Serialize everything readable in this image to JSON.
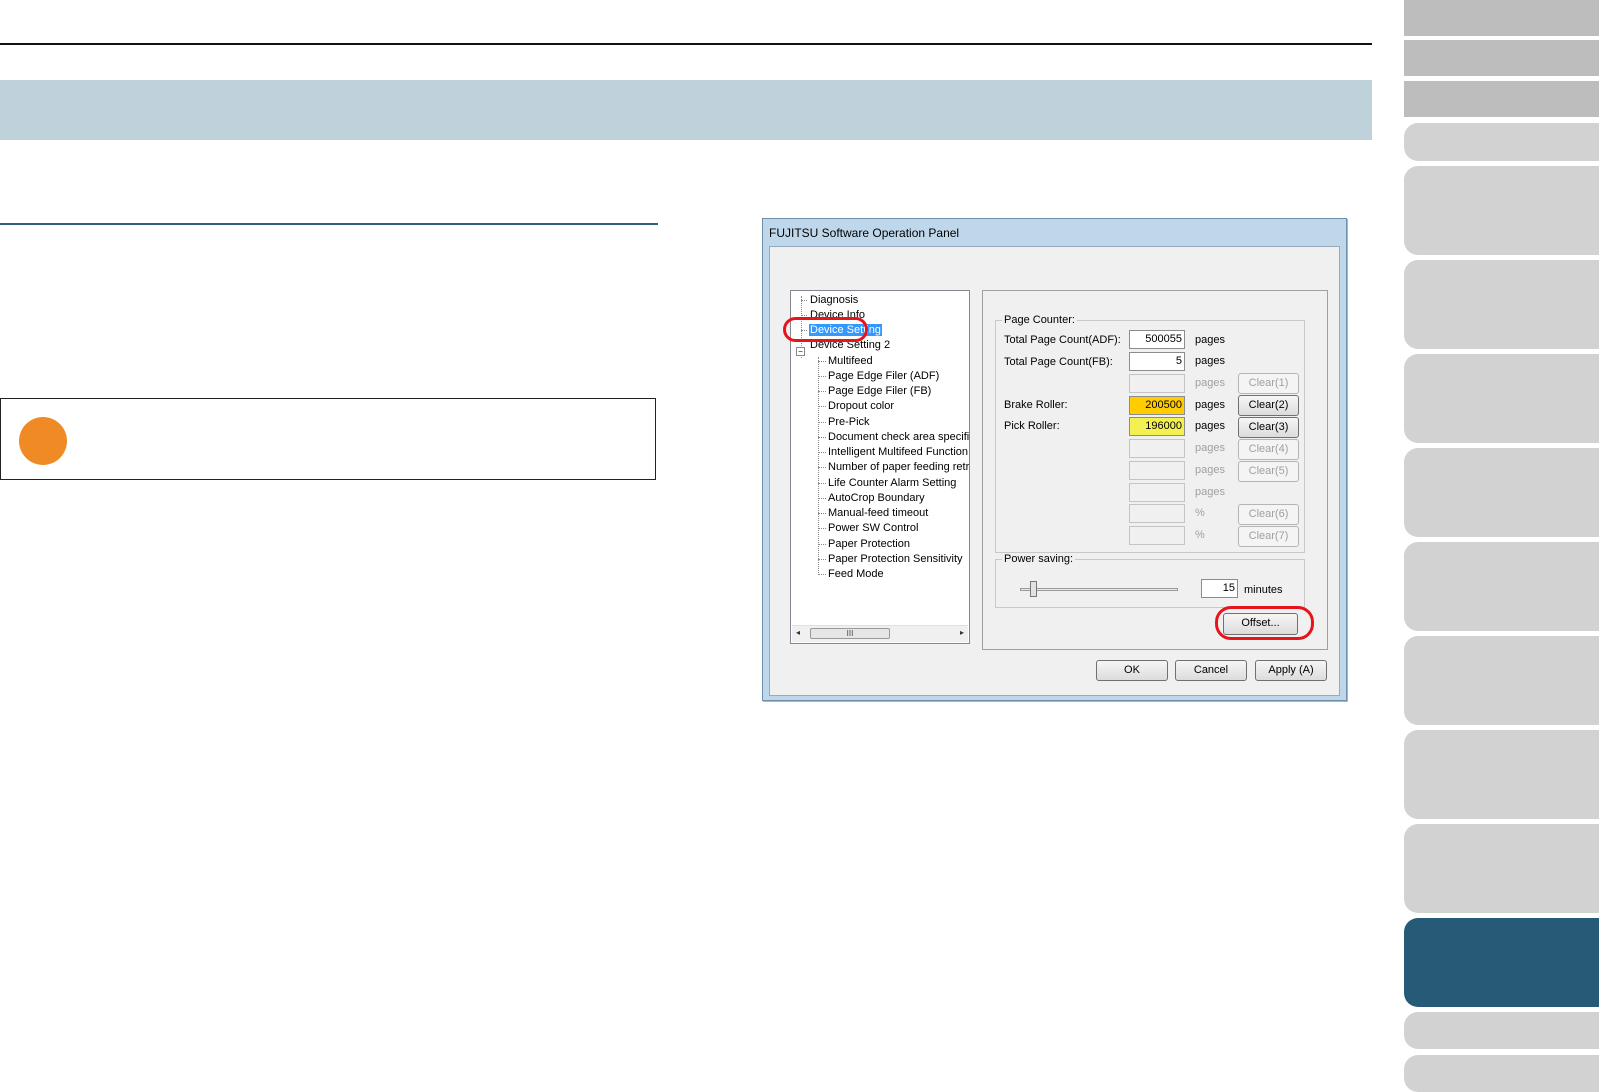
{
  "dialog": {
    "title": "FUJITSU Software Operation Panel",
    "tree": {
      "items": [
        "Diagnosis",
        "Device Info",
        "Device Setting",
        "Device Setting 2",
        "Multifeed",
        "Page Edge Filer (ADF)",
        "Page Edge Filer (FB)",
        "Dropout color",
        "Pre-Pick",
        "Document check area specific",
        "Intelligent Multifeed Function",
        "Number of paper feeding retrie",
        "Life Counter Alarm Setting",
        "AutoCrop Boundary",
        "Manual-feed timeout",
        "Power SW Control",
        "Paper Protection",
        "Paper Protection Sensitivity",
        "Feed Mode"
      ],
      "expander": "−",
      "scroll_thumb": "III",
      "scroll_left": "◂",
      "scroll_right": "▸"
    },
    "page_counter": {
      "label": "Page Counter:",
      "total_adf_label": "Total Page Count(ADF):",
      "total_adf_value": "500055",
      "total_fb_label": "Total Page Count(FB):",
      "total_fb_value": "5",
      "brake_label": "Brake Roller:",
      "brake_value": "200500",
      "pick_label": "Pick Roller:",
      "pick_value": "196000",
      "unit_pages": "pages",
      "unit_percent": "%",
      "clear1": "Clear(1)",
      "clear2": "Clear(2)",
      "clear3": "Clear(3)",
      "clear4": "Clear(4)",
      "clear5": "Clear(5)",
      "clear6": "Clear(6)",
      "clear7": "Clear(7)"
    },
    "power_saving": {
      "label": "Power saving:",
      "value": "15",
      "unit": "minutes"
    },
    "offset_button": "Offset...",
    "ok_button": "OK",
    "cancel_button": "Cancel",
    "apply_button": "Apply (A)"
  },
  "colors": {
    "title_band": "#bfd1db",
    "note_dot": "#f08a24",
    "active_tab": "#265a77",
    "highlight_ring": "#e8141c",
    "brake_field": "#ffcc00",
    "pick_field": "#f4f053"
  }
}
